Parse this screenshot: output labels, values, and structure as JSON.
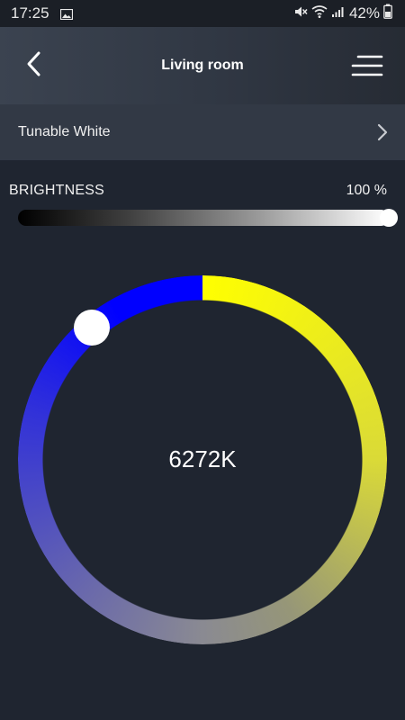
{
  "status_bar": {
    "time": "17:25",
    "battery": "42%"
  },
  "header": {
    "title": "Living room",
    "back_icon": "chevron-left-icon",
    "menu_icon": "menu-icon"
  },
  "mode": {
    "label": "Tunable White",
    "icon": "chevron-right-icon"
  },
  "brightness": {
    "label": "BRIGHTNESS",
    "value_text": "100 %",
    "percent": 100
  },
  "color_temperature": {
    "readout": "6272K",
    "thumb_angle_deg": 320
  },
  "colors": {
    "background": "#1f2530",
    "row_background": "#323945",
    "warm": "#ffff00",
    "cool": "#0000ff"
  }
}
